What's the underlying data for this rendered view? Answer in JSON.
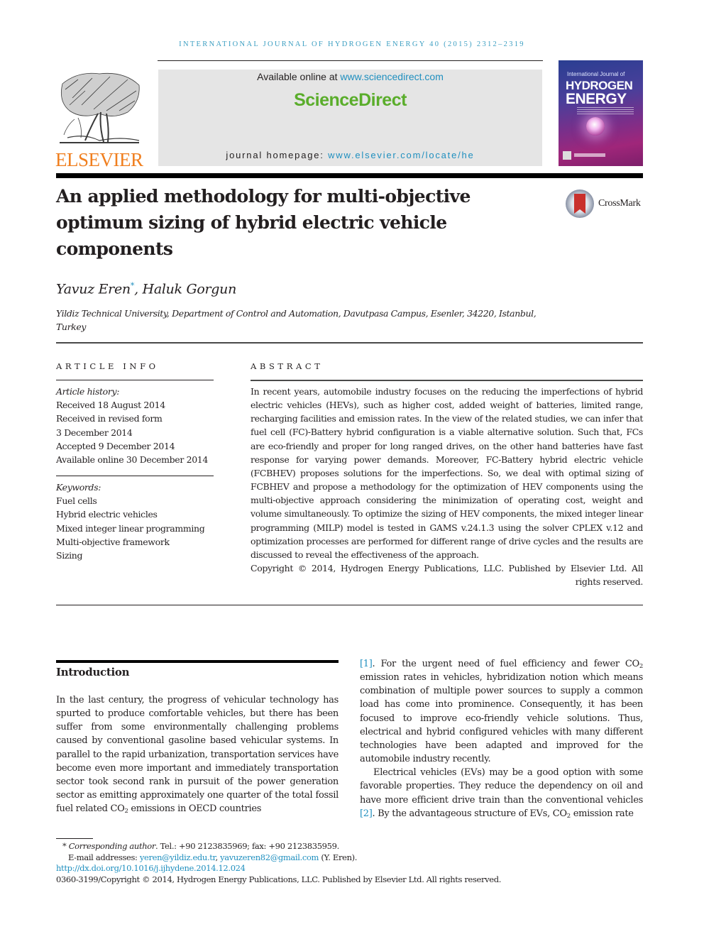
{
  "running_head": "INTERNATIONAL JOURNAL OF HYDROGEN ENERGY 40 (2015) 2312–2319",
  "publisher": {
    "logo_icon": "elsevier-tree-icon",
    "wordmark": "ELSEVIER"
  },
  "banner": {
    "available_prefix": "Available online at ",
    "available_link": "www.sciencedirect.com",
    "platform_name": "ScienceDirect",
    "homepage_prefix": "journal homepage: ",
    "homepage_link": "www.elsevier.com/locate/he"
  },
  "cover": {
    "kicker": "International Journal of",
    "title_line1": "HYDROGEN",
    "title_line2": "ENERGY"
  },
  "crossmark_label": "CrossMark",
  "title": "An applied methodology for multi-objective optimum sizing of hybrid electric vehicle components",
  "authors": [
    {
      "name": "Yavuz Eren",
      "mark": "*"
    },
    {
      "name": "Haluk Gorgun",
      "mark": ""
    }
  ],
  "author_separator": ", ",
  "affiliation": "Yildiz Technical University, Department of Control and Automation, Davutpasa Campus, Esenler, 34220, Istanbul, Turkey",
  "article_info": {
    "heading": "ARTICLE INFO",
    "history_label": "Article history:",
    "history": [
      "Received 18 August 2014",
      "Received in revised form",
      "3 December 2014",
      "Accepted 9 December 2014",
      "Available online 30 December 2014"
    ],
    "keywords_label": "Keywords:",
    "keywords": [
      "Fuel cells",
      "Hybrid electric vehicles",
      "Mixed integer linear programming",
      "Multi-objective framework",
      "Sizing"
    ]
  },
  "abstract": {
    "heading": "ABSTRACT",
    "text": "In recent years, automobile industry focuses on the reducing the imperfections of hybrid electric vehicles (HEVs), such as higher cost, added weight of batteries, limited range, recharging facilities and emission rates. In the view of the related studies, we can infer that fuel cell (FC)-Battery hybrid configuration is a viable alternative solution. Such that, FCs are eco-friendly and proper for long ranged drives, on the other hand batteries have fast response for varying power demands. Moreover, FC-Battery hybrid electric vehicle (FCBHEV) proposes solutions for the imperfections. So, we deal with optimal sizing of FCBHEV and propose a methodology for the optimization of HEV components using the multi-objective approach considering the minimization of operating cost, weight and volume simultaneously. To optimize the sizing of HEV components, the mixed integer linear programming (MILP) model is tested in GAMS v.24.1.3 using the solver CPLEX v.12 and optimization processes are performed for different range of drive cycles and the results are discussed to reveal the effectiveness of the approach.",
    "copyright": "Copyright © 2014, Hydrogen Energy Publications, LLC. Published by Elsevier Ltd. All rights reserved."
  },
  "introduction": {
    "heading": "Introduction",
    "p1_a": "In the last century, the progress of vehicular technology has spurted to produce comfortable vehicles, but there has been suffer from some environmentally challenging problems caused by conventional gasoline based vehicular systems. In parallel to the rapid urbanization, transportation services have become even more important and immediately transportation sector took second rank in pursuit of the power generation sector as emitting approximately one quarter of the total fossil fuel related CO",
    "p1_sub": "2",
    "p1_b": " emissions in OECD countries ",
    "ref1": "[1]",
    "p1_c": ". For the urgent need of fuel efficiency and fewer CO",
    "p1_sub2": "2",
    "p1_d": " emission rates in vehicles, hybridization notion which means combination of multiple power sources to supply a common load has come into prominence. Consequently, it has been focused to improve eco-friendly vehicle solutions. Thus, electrical and hybrid configured vehicles with many different technologies have been adapted and improved for the automobile industry recently.",
    "p2_a": "Electrical vehicles (EVs) may be a good option with some favorable properties. They reduce the dependency on oil and have more efficient drive train than the conventional vehicles ",
    "ref2": "[2]",
    "p2_b": ". By the advantageous structure of EVs, CO",
    "p2_sub": "2",
    "p2_c": " emission rate"
  },
  "footnotes": {
    "corresponding_label": "Corresponding author",
    "corresponding_rest": ". Tel.: +90 2123835969; fax: +90 2123835959.",
    "email_label": "E-mail addresses: ",
    "email1": "yeren@yildiz.edu.tr",
    "email_sep": ", ",
    "email2": "yavuzeren82@gmail.com",
    "email_suffix": " (Y. Eren).",
    "doi": "http://dx.doi.org/10.1016/j.ijhydene.2014.12.024",
    "issn_copyright": "0360-3199/Copyright © 2014, Hydrogen Energy Publications, LLC. Published by Elsevier Ltd. All rights reserved."
  }
}
